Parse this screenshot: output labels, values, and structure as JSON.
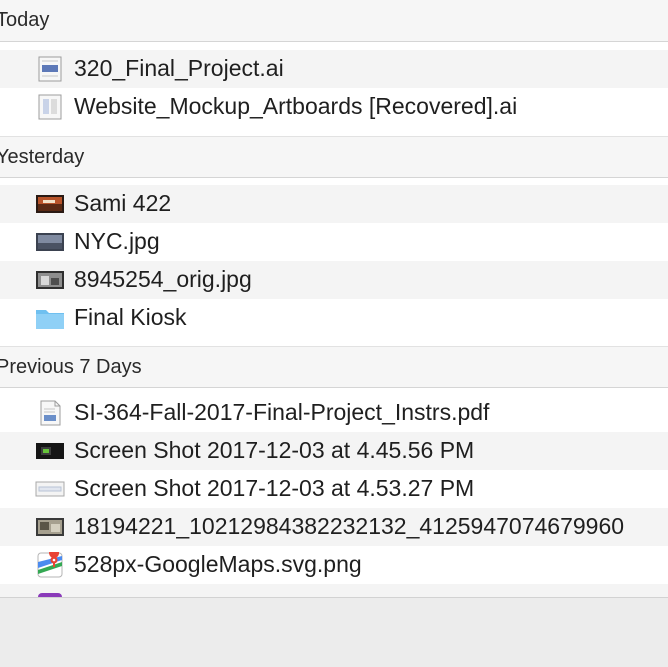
{
  "groups": [
    {
      "label": "Today",
      "items": [
        {
          "name": "320_Final_Project.ai",
          "icon": "illustrator-document-icon"
        },
        {
          "name": "Website_Mockup_Artboards [Recovered].ai",
          "icon": "illustrator-document-icon"
        }
      ]
    },
    {
      "label": "Yesterday",
      "items": [
        {
          "name": "Sami 422",
          "icon": "image-thumbnail-icon"
        },
        {
          "name": "NYC.jpg",
          "icon": "image-thumbnail-icon"
        },
        {
          "name": "8945254_orig.jpg",
          "icon": "image-thumbnail-icon"
        },
        {
          "name": "Final Kiosk",
          "icon": "folder-icon"
        }
      ]
    },
    {
      "label": "Previous 7 Days",
      "items": [
        {
          "name": "SI-364-Fall-2017-Final-Project_Instrs.pdf",
          "icon": "pdf-document-icon"
        },
        {
          "name": "Screen Shot 2017-12-03 at 4.45.56 PM",
          "icon": "screenshot-thumbnail-icon"
        },
        {
          "name": "Screen Shot 2017-12-03 at 4.53.27 PM",
          "icon": "screenshot-thumbnail-icon"
        },
        {
          "name": "18194221_10212984382232132_4125947074679960",
          "icon": "image-thumbnail-icon"
        },
        {
          "name": "528px-GoogleMaps.svg.png",
          "icon": "google-maps-thumbnail-icon"
        }
      ]
    }
  ]
}
